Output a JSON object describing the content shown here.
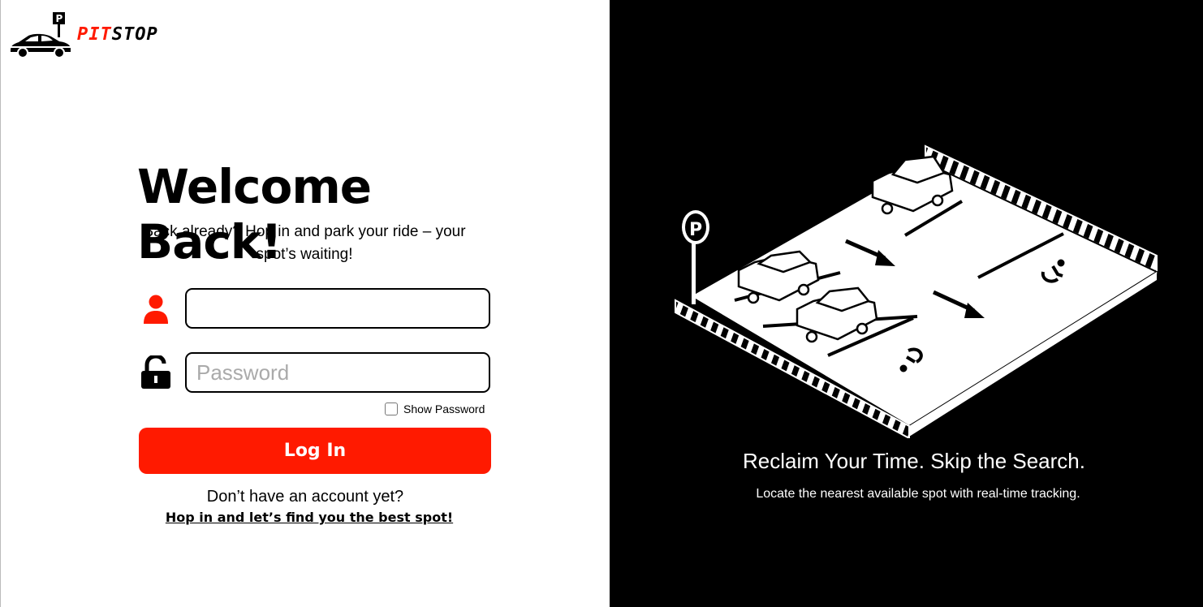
{
  "brand": {
    "name_part1": "PIT",
    "name_part2": "STOP",
    "color_accent": "#ff1a00"
  },
  "login": {
    "title": "Welcome Back!",
    "subtitle": "Back already? Hop in and park your ride – your spot’s waiting!",
    "username": {
      "value": "",
      "placeholder": ""
    },
    "password": {
      "value": "",
      "placeholder": "Password"
    },
    "show_password_label": "Show Password",
    "show_password_checked": false,
    "login_button": "Log In",
    "no_account_text": "Don’t have an account yet?",
    "signup_link": " Hop in and let’s find you the best spot!"
  },
  "promo": {
    "heading": "Reclaim Your Time. Skip the Search.",
    "subheading": "Locate the nearest available spot with real-time tracking."
  },
  "icons": [
    "parking-car-logo-icon",
    "user-icon",
    "unlock-icon",
    "parking-lot-illustration"
  ]
}
